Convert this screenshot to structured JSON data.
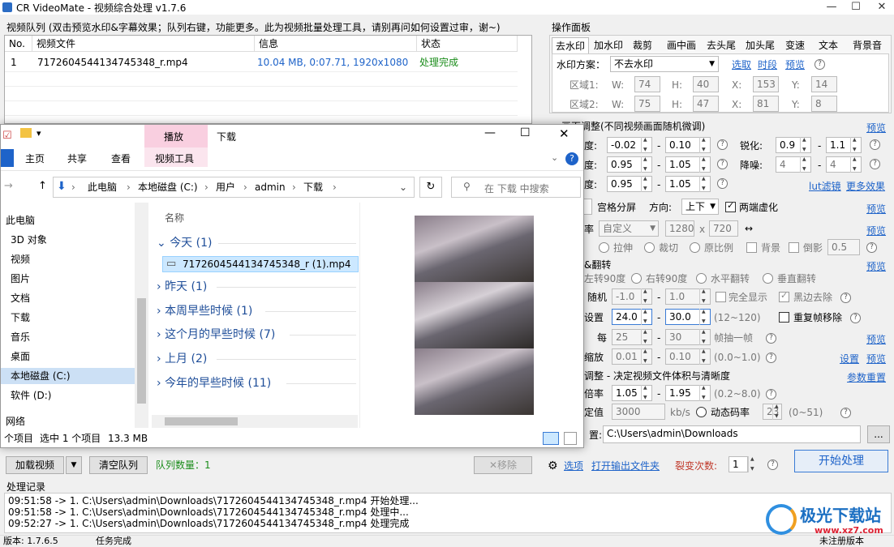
{
  "window": {
    "title": "CR VideoMate - 视频综合处理 v1.7.6",
    "min": "—",
    "max": "☐",
    "close": "✕"
  },
  "queue": {
    "title": "视频队列 (双击预览水印&字幕效果；队列右键，功能更多。此为视频批量处理工具，请别再问如何设置过审，谢~)",
    "columns": [
      "No.",
      "视频文件",
      "信息",
      "状态"
    ],
    "rows": [
      {
        "no": "1",
        "file": "717260454413474534 8_r.mp4",
        "info": "10.04 MB, 0:07.71, 1920x1080",
        "status": "处理完成"
      }
    ]
  },
  "queue_buttons": {
    "load": "加载视频",
    "clear": "清空队列",
    "count": "队列数量：1",
    "remove": "移除"
  },
  "panel": {
    "title": "操作面板",
    "tabs": [
      "去水印",
      "加水印",
      "裁剪",
      "画中画",
      "去头尾",
      "加头尾",
      "变速",
      "文本",
      "背景音"
    ],
    "watermark_label": "水印方案：",
    "watermark_value": "不去水印",
    "links": [
      "选取",
      "时段",
      "预览"
    ],
    "region1": {
      "label": "区域1:",
      "w": "74",
      "h": "40",
      "x": "153",
      "y": "14"
    },
    "region2": {
      "label": "区域2:",
      "w": "75",
      "h": "47",
      "x": "81",
      "y": "8"
    }
  },
  "adjust": {
    "title": "画面调整(不同视频画面随机微调)",
    "preview": "预览",
    "rows": [
      {
        "label": "度:",
        "a": "-0.02",
        "b": "0.10",
        "lab2": "锐化:",
        "c": "0.9",
        "d": "1.1"
      },
      {
        "label": "度:",
        "a": "0.95",
        "b": "1.05",
        "lab2": "降噪:",
        "c": "4",
        "d": "4"
      },
      {
        "label": "度:",
        "a": "0.95",
        "b": "1.05",
        "lab2": "",
        "c": "",
        "d": ""
      }
    ],
    "lut": "lut滤镜",
    "more": "更多效果",
    "grid": "宫格分屏",
    "direction": "方向:",
    "direction_value": "上下",
    "blur": "两端虚化",
    "preview2": "预览",
    "rate_label": "率",
    "rate_value": "自定义",
    "res_w": "1280",
    "res_h": "720",
    "preview3": "预览",
    "scale_opts": [
      "拉伸",
      "裁切",
      "原比例",
      "背景",
      "倒影"
    ],
    "scale_num": "0.5",
    "rotate_title": "&翻转",
    "preview4": "预览",
    "rotate_opts": [
      "左转90度",
      "右转90度",
      "水平翻转",
      "垂直翻转"
    ],
    "random_label": "随机",
    "rand_a": "-1.0",
    "rand_b": "1.0",
    "full": "完全显示",
    "blackedge": "黑边去除",
    "fps_label": "设置",
    "fps_a": "24.0",
    "fps_b": "30.0",
    "fps_range": "(12~120)",
    "reorder": "重复帧移除",
    "every_label": "每",
    "every_a": "25",
    "every_b": "30",
    "every_txt": "帧抽一帧",
    "preview5": "预览",
    "zoom_label": "缩放",
    "zoom_a": "0.01",
    "zoom_b": "0.10",
    "zoom_range": "(0.0~1.0)",
    "setting": "设置",
    "preview6": "预览"
  },
  "bitrate": {
    "title": "调整 - 决定视频文件体积与清晰度",
    "reset": "参数重置",
    "mult_label": "倍率",
    "mult_a": "1.05",
    "mult_b": "1.95",
    "mult_range": "(0.2~8.0)",
    "fixed_label": "定值",
    "fixed_value": "3000",
    "unit": "kb/s",
    "dynamic": "动态码率",
    "dyn_value": "23",
    "dyn_range": "(0~51)"
  },
  "output": {
    "label": "置:",
    "path": "C:\\Users\\admin\\Downloads",
    "browse": "..."
  },
  "actions": {
    "options": "选项",
    "open_folder": "打开输出文件夹",
    "split_label": "裂变次数:",
    "split_value": "1",
    "start": "开始处理"
  },
  "log": {
    "title": "处理记录",
    "lines": [
      "09:51:58 -> 1. C:\\Users\\admin\\Downloads\\7172604544134745348_r.mp4 开始处理...",
      "09:51:58 -> 1. C:\\Users\\admin\\Downloads\\7172604544134745348_r.mp4 处理中...",
      "09:52:27 -> 1. C:\\Users\\admin\\Downloads\\7172604544134745348_r.mp4 处理完成"
    ]
  },
  "status": {
    "version": "版本: 1.7.6.5",
    "task": "任务完成",
    "reg": "未注册版本"
  },
  "explorer": {
    "title": "下载",
    "context_tab": "播放",
    "context_sub": "视频工具",
    "ribbon": [
      "主页",
      "共享",
      "查看"
    ],
    "crumbs": [
      "此电脑",
      "本地磁盘 (C:)",
      "用户",
      "admin",
      "下载"
    ],
    "search_placeholder": "在 下载 中搜索",
    "nav": [
      "此电脑",
      "3D 对象",
      "视频",
      "图片",
      "文档",
      "下载",
      "音乐",
      "桌面",
      "本地磁盘 (C:)",
      "软件 (D:)",
      "网络"
    ],
    "column": "名称",
    "groups": [
      "今天 (1)",
      "昨天 (1)",
      "本周早些时候 (1)",
      "这个月的早些时候 (7)",
      "上月 (2)",
      "今年的早些时候 (11)"
    ],
    "file": "7172604544134745348_r (1).mp4",
    "status_items": "个项目",
    "status_sel": "选中 1 个项目",
    "status_size": "13.3 MB"
  },
  "watermark_logo": {
    "name": "极光下载站",
    "url": "www.xz7.com"
  }
}
